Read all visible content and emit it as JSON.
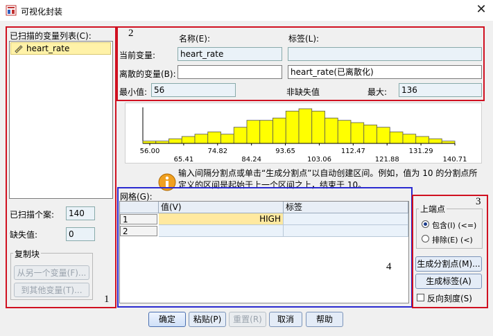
{
  "window": {
    "title": "可视化封装",
    "close_glyph": "✕"
  },
  "variable_list": {
    "label": "已扫描的变量列表(C):",
    "items": [
      {
        "name": "heart_rate"
      }
    ]
  },
  "current": {
    "name_header": "名称(E):",
    "label_header": "标签(L):",
    "current_var_label": "当前变量:",
    "current_var_name": "heart_rate",
    "current_var_label_value": "",
    "binned_var_label": "离散的变量(B):",
    "binned_var_name": "",
    "binned_var_label_value": "heart_rate(已离散化)",
    "min_label": "最小值:",
    "min_value": "56",
    "nonmissing_label": "非缺失值",
    "max_label": "最大:",
    "max_value": "136"
  },
  "chart_data": {
    "type": "bar",
    "tick_labels": [
      "56.00",
      "65.41",
      "74.82",
      "84.24",
      "93.65",
      "103.06",
      "112.47",
      "121.88",
      "131.29",
      "140.71"
    ],
    "xlim": [
      56.0,
      140.71
    ],
    "values": [
      1,
      1,
      2,
      3,
      4,
      5,
      4,
      7,
      10,
      10,
      11,
      14,
      15,
      14,
      11,
      10,
      9,
      8,
      7,
      5,
      4,
      3,
      2,
      1
    ],
    "bar_color": "#ffff00",
    "grid": false
  },
  "info": {
    "text": "输入间隔分割点或单击“生成分割点”以自动创建区间。例如，值为 10 的分割点所定义的区间是起始于上一个区间之上，结束于 10。"
  },
  "grid": {
    "label": "网格(G):",
    "columns": [
      "值(V)",
      "标签"
    ],
    "rows": [
      {
        "index": "1",
        "value": "HIGH",
        "label": ""
      },
      {
        "index": "2",
        "value": "",
        "label": ""
      }
    ]
  },
  "scan": {
    "cases_label": "已扫描个案:",
    "cases_value": "140",
    "missing_label": "缺失值:",
    "missing_value": "0"
  },
  "copy_group": {
    "title": "复制块",
    "from_button": "从另一个变量(F)...",
    "to_button": "到其他变量(T)..."
  },
  "endpoints": {
    "title": "上端点",
    "include": "包含(I) (<=)",
    "exclude": "排除(E) (<)",
    "selected": "include"
  },
  "actions": {
    "make_cutpoints": "生成分割点(M)...",
    "make_labels": "生成标签(A)",
    "reverse": "反向刻度(S)"
  },
  "footer": {
    "ok": "确定",
    "paste": "粘贴(P)",
    "reset": "重置(R)",
    "cancel": "取消",
    "help": "帮助"
  },
  "annotations": {
    "n1": "1",
    "n2": "2",
    "n3": "3",
    "n4": "4"
  },
  "colors": {
    "annotation_red": "#d01020",
    "annotation_blue": "#2a2ad0",
    "highlight": "#ffe9a0"
  }
}
